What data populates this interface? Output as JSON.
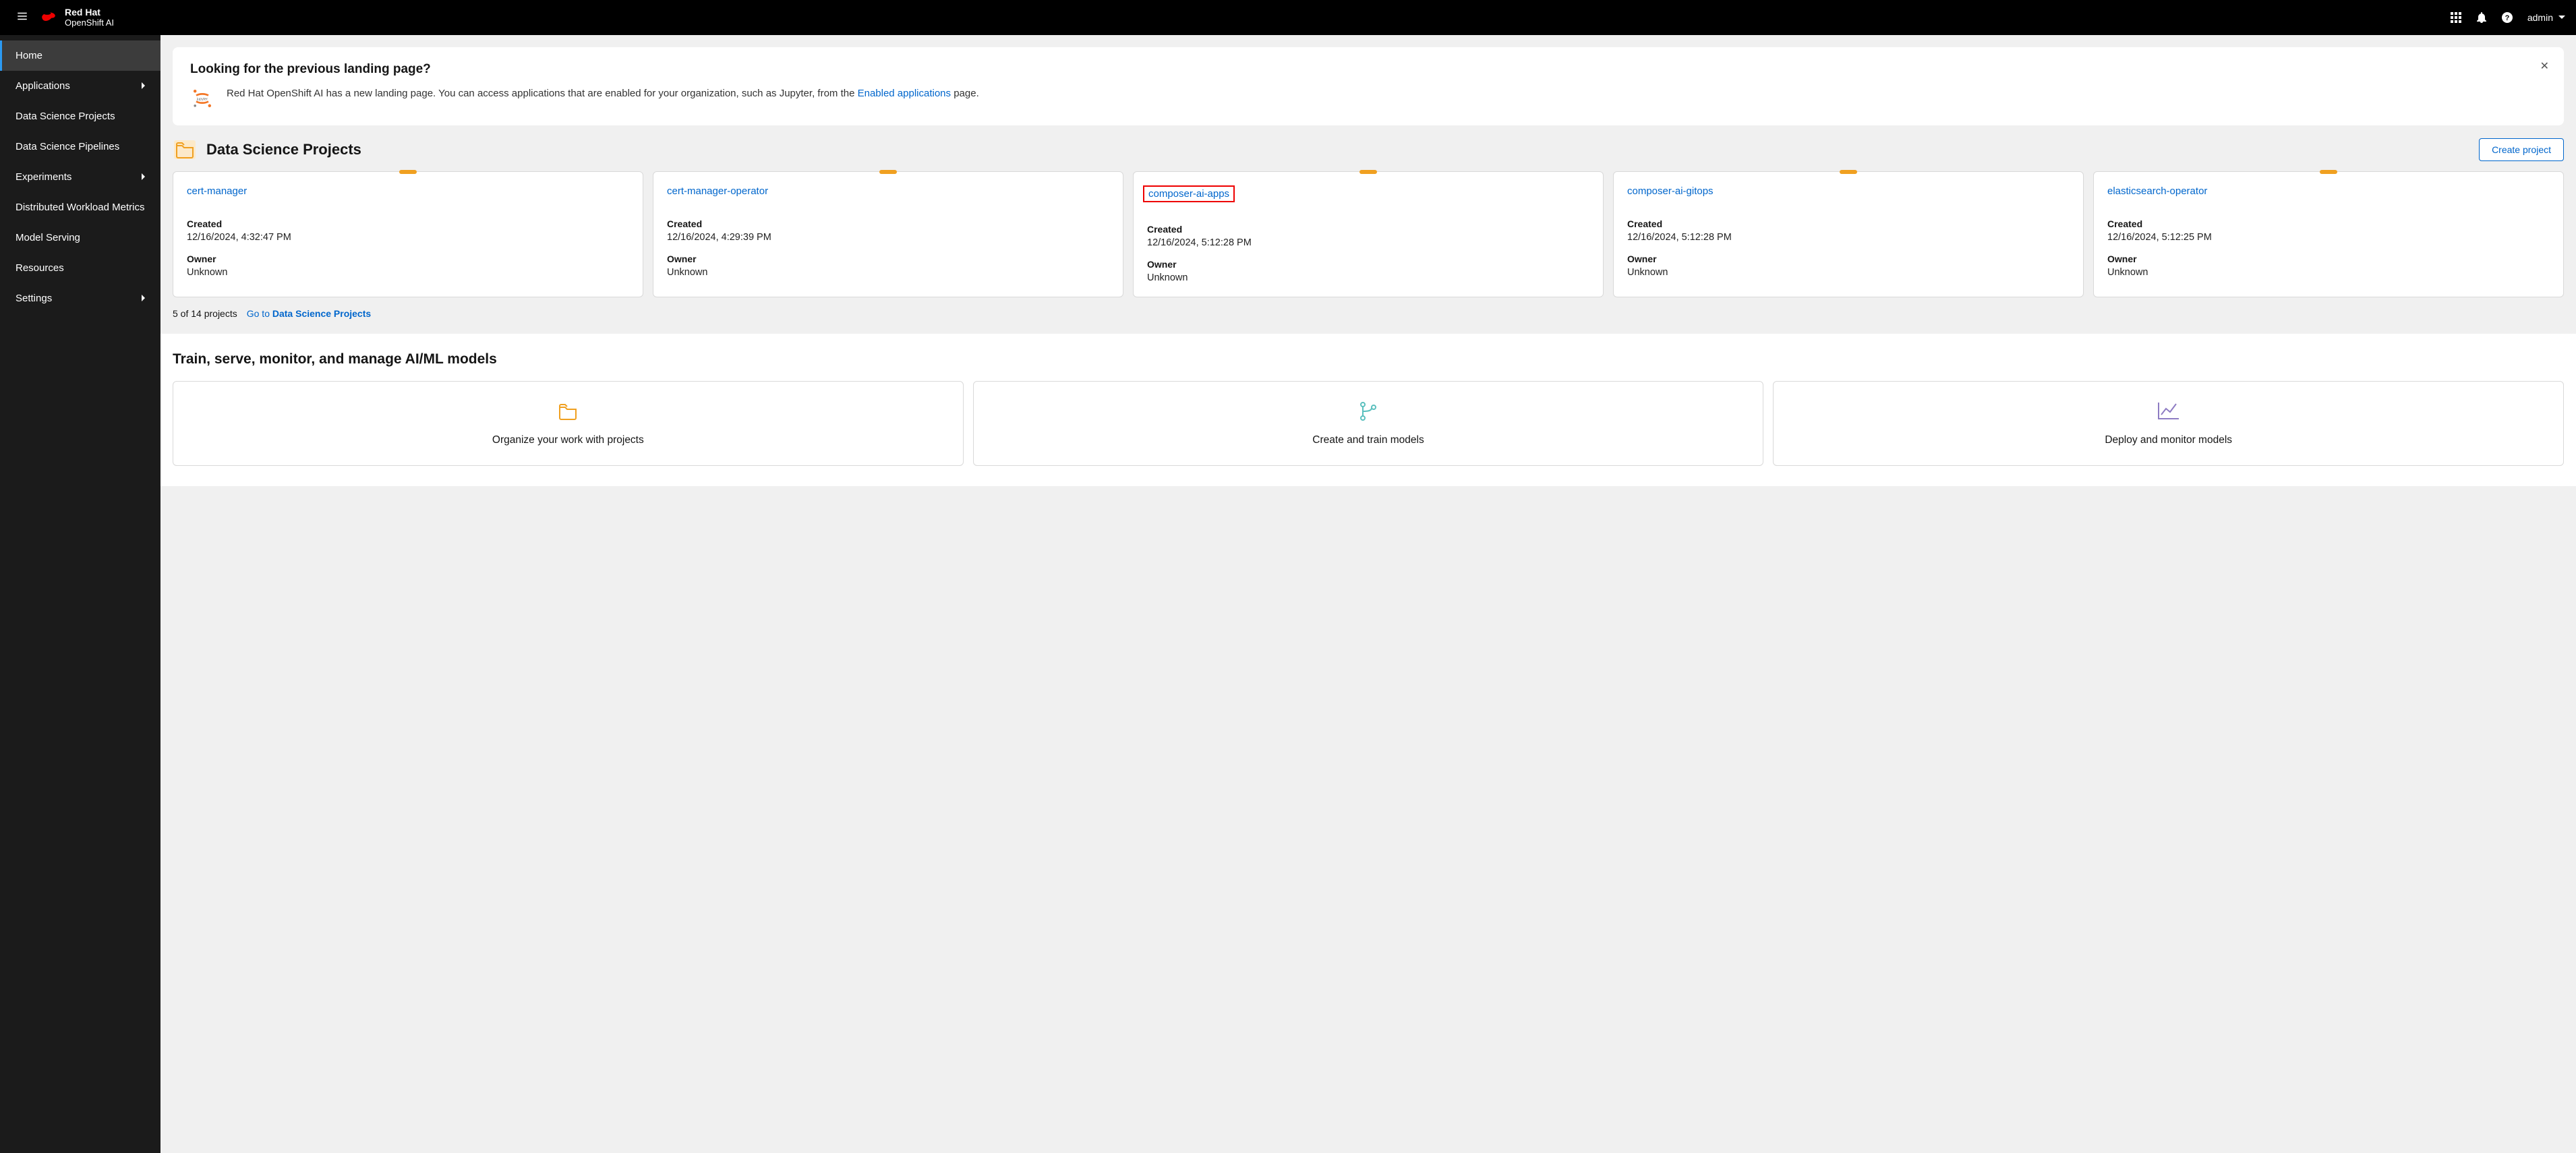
{
  "header": {
    "brand_line1": "Red Hat",
    "brand_line2": "OpenShift AI",
    "user": "admin"
  },
  "sidebar": {
    "items": [
      {
        "label": "Home",
        "expandable": false,
        "active": true
      },
      {
        "label": "Applications",
        "expandable": true,
        "active": false
      },
      {
        "label": "Data Science Projects",
        "expandable": false,
        "active": false
      },
      {
        "label": "Data Science Pipelines",
        "expandable": false,
        "active": false
      },
      {
        "label": "Experiments",
        "expandable": true,
        "active": false
      },
      {
        "label": "Distributed Workload Metrics",
        "expandable": false,
        "active": false
      },
      {
        "label": "Model Serving",
        "expandable": false,
        "active": false
      },
      {
        "label": "Resources",
        "expandable": false,
        "active": false
      },
      {
        "label": "Settings",
        "expandable": true,
        "active": false
      }
    ]
  },
  "banner": {
    "title": "Looking for the previous landing page?",
    "text_pre": "Red Hat OpenShift AI has a new landing page. You can access applications that are enabled for your organization, such as Jupyter, from the ",
    "link_text": "Enabled applications",
    "text_post": " page."
  },
  "projects_section": {
    "title": "Data Science Projects",
    "create_button": "Create project",
    "created_label": "Created",
    "owner_label": "Owner",
    "cards": [
      {
        "name": "cert-manager",
        "created": "12/16/2024, 4:32:47 PM",
        "owner": "Unknown",
        "highlighted": false
      },
      {
        "name": "cert-manager-operator",
        "created": "12/16/2024, 4:29:39 PM",
        "owner": "Unknown",
        "highlighted": false
      },
      {
        "name": "composer-ai-apps",
        "created": "12/16/2024, 5:12:28 PM",
        "owner": "Unknown",
        "highlighted": true
      },
      {
        "name": "composer-ai-gitops",
        "created": "12/16/2024, 5:12:28 PM",
        "owner": "Unknown",
        "highlighted": false
      },
      {
        "name": "elasticsearch-operator",
        "created": "12/16/2024, 5:12:25 PM",
        "owner": "Unknown",
        "highlighted": false
      }
    ],
    "pager_count": "5 of 14 projects",
    "pager_link_pre": "Go to ",
    "pager_link_bold": "Data Science Projects"
  },
  "bottom": {
    "title": "Train, serve, monitor, and manage AI/ML models",
    "cards": [
      {
        "text": "Organize your work with projects",
        "icon": "folder"
      },
      {
        "text": "Create and train models",
        "icon": "branch"
      },
      {
        "text": "Deploy and monitor models",
        "icon": "chart"
      }
    ]
  }
}
